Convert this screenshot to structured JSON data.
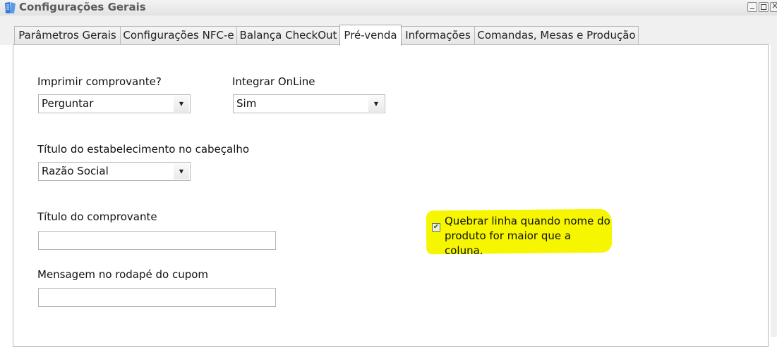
{
  "window": {
    "title": "Configurações Gerais"
  },
  "tabs": [
    {
      "label": "Parâmetros Gerais"
    },
    {
      "label": "Configurações NFC-e"
    },
    {
      "label": "Balança CheckOut"
    },
    {
      "label": "Pré-venda"
    },
    {
      "label": "Informações"
    },
    {
      "label": "Comandas, Mesas e Produção"
    }
  ],
  "active_tab": "Pré-venda",
  "form": {
    "imprimir": {
      "label": "Imprimir comprovante?",
      "value": "Perguntar"
    },
    "integrar": {
      "label": "Integrar OnLine",
      "value": "Sim"
    },
    "titulo_estab": {
      "label": "Título do estabelecimento no cabeçalho",
      "value": "Razão Social"
    },
    "titulo_comprovante": {
      "label": "Título do comprovante",
      "value": ""
    },
    "mensagem_rodape": {
      "label": "Mensagem no rodapé do cupom",
      "value": ""
    },
    "quebrar_linha": {
      "label": "Quebrar linha quando nome do produto for maior que a coluna.",
      "checked": true
    }
  },
  "icons": {
    "dropdown": "chevron-down-icon",
    "checkmark": "checkmark-icon"
  },
  "colors": {
    "highlight": "#f6f600",
    "tab_border": "#b9b9b9"
  }
}
